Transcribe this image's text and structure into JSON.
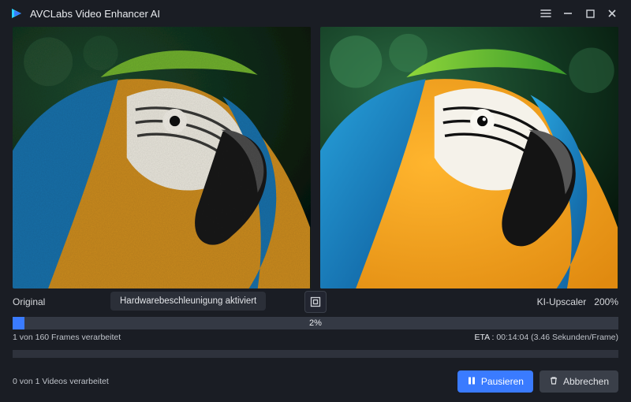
{
  "app": {
    "title": "AVCLabs Video Enhancer AI"
  },
  "preview": {
    "left_label": "Original",
    "right_label": "KI-Upscaler",
    "scale": "200%",
    "tooltip": "Hardwarebeschleunigung aktiviert"
  },
  "progress": {
    "frames": {
      "percent": 2,
      "percent_label": "2%",
      "status": "1 von 160 Frames verarbeitet",
      "eta_label": "ETA :",
      "eta_value": "00:14:04 (3.46 Sekunden/Frame)"
    },
    "videos": {
      "percent": 0,
      "status": "0 von 1 Videos verarbeitet"
    }
  },
  "buttons": {
    "pause": "Pausieren",
    "cancel": "Abbrechen"
  }
}
